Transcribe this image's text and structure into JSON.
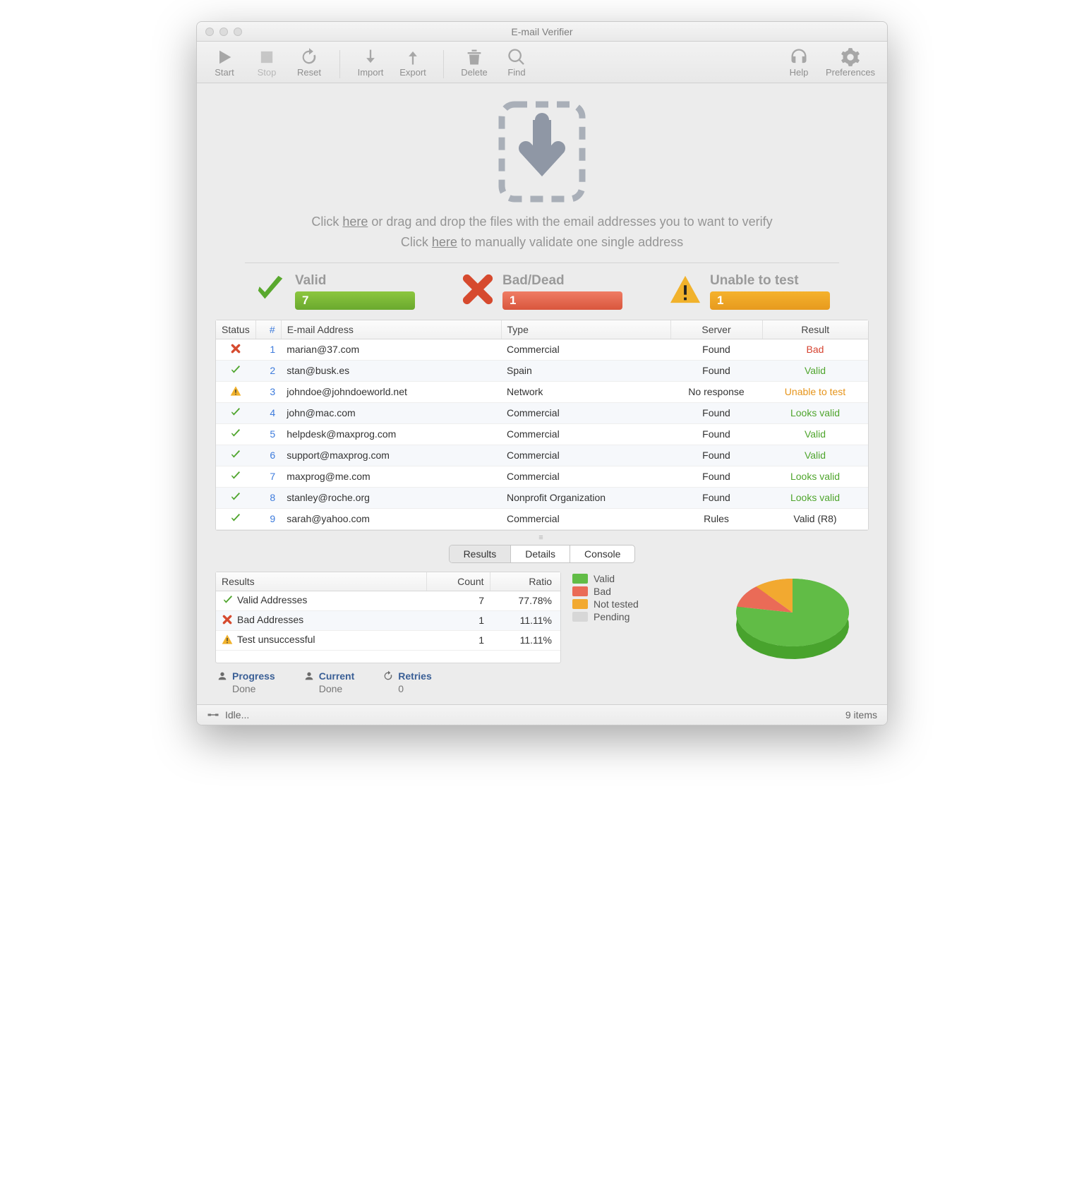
{
  "title": "E-mail Verifier",
  "toolbar": {
    "start": "Start",
    "stop": "Stop",
    "reset": "Reset",
    "import": "Import",
    "export": "Export",
    "delete": "Delete",
    "find": "Find",
    "help": "Help",
    "preferences": "Preferences"
  },
  "drop": {
    "line1_a": "Click ",
    "line1_link": "here",
    "line1_b": " or drag and drop the files with the email addresses you to want to verify",
    "line2_a": "Click ",
    "line2_link": "here",
    "line2_b": " to manually validate one single address"
  },
  "stats": {
    "valid": {
      "label": "Valid",
      "count": "7"
    },
    "bad": {
      "label": "Bad/Dead",
      "count": "1"
    },
    "untest": {
      "label": "Unable to test",
      "count": "1"
    }
  },
  "columns": {
    "status": "Status",
    "num": "#",
    "email": "E-mail Address",
    "type": "Type",
    "server": "Server",
    "result": "Result"
  },
  "rows": [
    {
      "status": "bad",
      "num": "1",
      "email": "marian@37.com",
      "type": "Commercial",
      "server": "Found",
      "result": "Bad",
      "rclass": "res-bad"
    },
    {
      "status": "valid",
      "num": "2",
      "email": "stan@busk.es",
      "type": "Spain",
      "server": "Found",
      "result": "Valid",
      "rclass": "res-valid"
    },
    {
      "status": "warn",
      "num": "3",
      "email": "johndoe@johndoeworld.net",
      "type": "Network",
      "server": "No response",
      "result": "Unable to test",
      "rclass": "res-untest"
    },
    {
      "status": "valid",
      "num": "4",
      "email": "john@mac.com",
      "type": "Commercial",
      "server": "Found",
      "result": "Looks valid",
      "rclass": "res-valid"
    },
    {
      "status": "valid",
      "num": "5",
      "email": "helpdesk@maxprog.com",
      "type": "Commercial",
      "server": "Found",
      "result": "Valid",
      "rclass": "res-valid"
    },
    {
      "status": "valid",
      "num": "6",
      "email": "support@maxprog.com",
      "type": "Commercial",
      "server": "Found",
      "result": "Valid",
      "rclass": "res-valid"
    },
    {
      "status": "valid",
      "num": "7",
      "email": "maxprog@me.com",
      "type": "Commercial",
      "server": "Found",
      "result": "Looks valid",
      "rclass": "res-valid"
    },
    {
      "status": "valid",
      "num": "8",
      "email": "stanley@roche.org",
      "type": "Nonprofit Organization",
      "server": "Found",
      "result": "Looks valid",
      "rclass": "res-valid"
    },
    {
      "status": "valid",
      "num": "9",
      "email": "sarah@yahoo.com",
      "type": "Commercial",
      "server": "Rules",
      "result": "Valid (R8)",
      "rclass": "res-black"
    }
  ],
  "tabs": {
    "results": "Results",
    "details": "Details",
    "console": "Console"
  },
  "summary": {
    "headers": {
      "results": "Results",
      "count": "Count",
      "ratio": "Ratio"
    },
    "rows": [
      {
        "icon": "valid",
        "label": "Valid Addresses",
        "count": "7",
        "ratio": "77.78%"
      },
      {
        "icon": "bad",
        "label": "Bad Addresses",
        "count": "1",
        "ratio": "11.11%"
      },
      {
        "icon": "warn",
        "label": "Test unsuccessful",
        "count": "1",
        "ratio": "11.11%"
      }
    ]
  },
  "legend": {
    "valid": "Valid",
    "bad": "Bad",
    "nottested": "Not tested",
    "pending": "Pending"
  },
  "status": {
    "progress": {
      "label": "Progress",
      "value": "Done"
    },
    "current": {
      "label": "Current",
      "value": "Done"
    },
    "retries": {
      "label": "Retries",
      "value": "0"
    }
  },
  "footer": {
    "idle": "Idle...",
    "items": "9 items"
  },
  "colors": {
    "green": "#61bc46",
    "red": "#ea6b57",
    "orange": "#f2a930",
    "grey": "#d7d7d7"
  },
  "chart_data": {
    "type": "pie",
    "title": "",
    "series": [
      {
        "name": "Valid",
        "value": 77.78,
        "color": "#61bc46"
      },
      {
        "name": "Bad",
        "value": 11.11,
        "color": "#ea6b57"
      },
      {
        "name": "Not tested",
        "value": 11.11,
        "color": "#f2a930"
      },
      {
        "name": "Pending",
        "value": 0,
        "color": "#d7d7d7"
      }
    ]
  }
}
